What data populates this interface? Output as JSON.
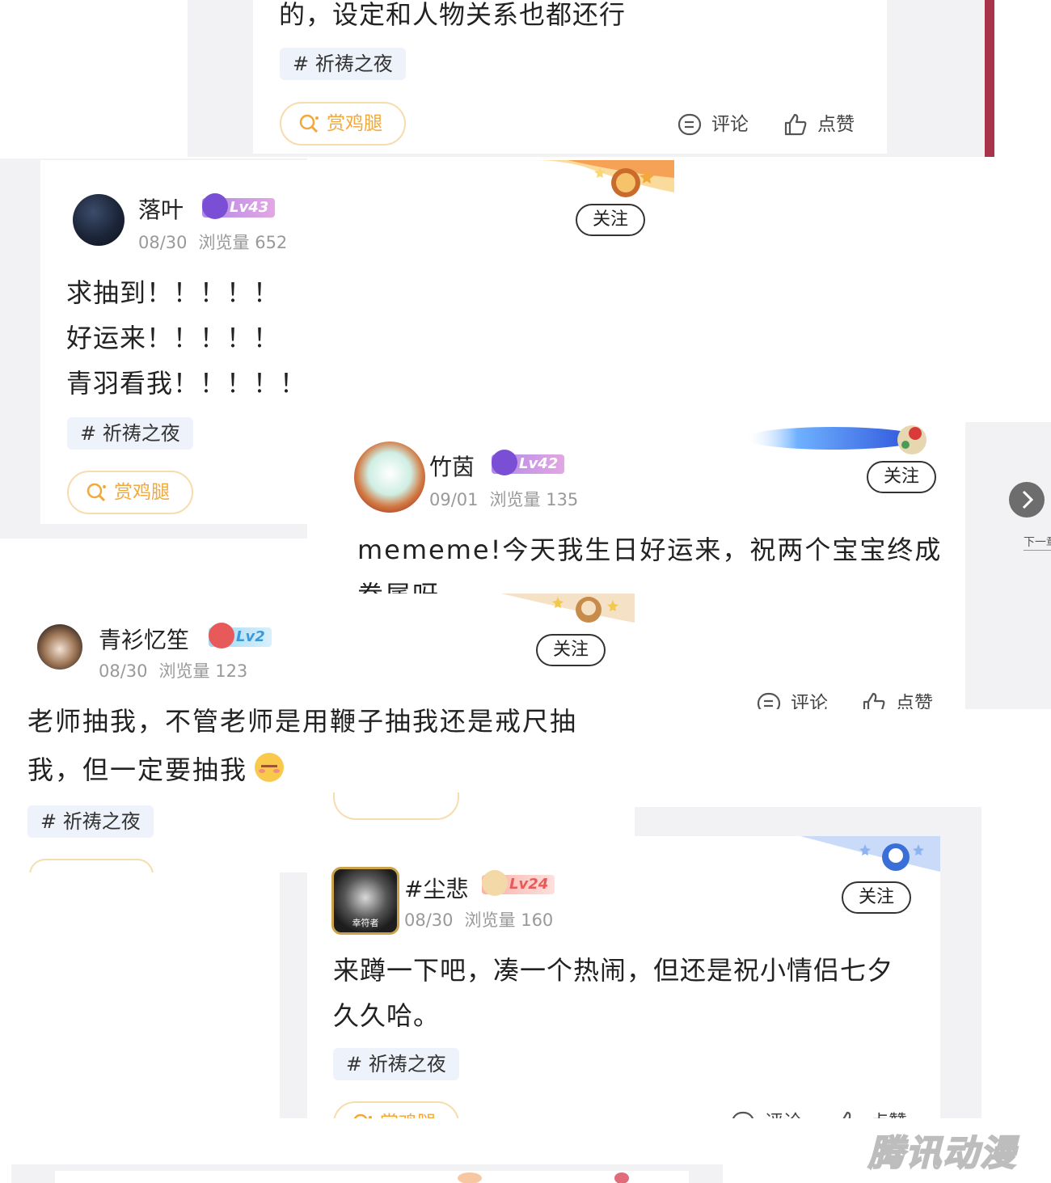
{
  "colors": {
    "accent_orange": "#f2a93b",
    "tag_bg": "#eef2fa",
    "meta_gray": "#999999",
    "side_strip": "#a8344a"
  },
  "top_card": {
    "text_line": "的，设定和人物关系也都还行",
    "tag": "# 祈祷之夜",
    "reward_label": "赏鸡腿",
    "comment_label": "评论",
    "like_label": "点赞"
  },
  "posts": [
    {
      "username": "落叶",
      "level": "Lv43",
      "date": "08/30",
      "views": "浏览量 652",
      "follow_label": "关注",
      "lines": [
        "求抽到！！！！！",
        "好运来！！！！！",
        "青羽看我！！！！！"
      ],
      "tag": "# 祈祷之夜",
      "reward_label": "赏鸡腿"
    },
    {
      "username": "竹茵",
      "level": "Lv42",
      "date": "09/01",
      "views": "浏览量 135",
      "follow_label": "关注",
      "lines": [
        "mememe!今天我生日好运来，祝两个宝宝终成",
        "眷属呀"
      ],
      "comment_label": "评论",
      "like_label": "点赞"
    },
    {
      "username": "青衫忆笙",
      "level": "Lv2",
      "date": "08/30",
      "views": "浏览量 123",
      "follow_label": "关注",
      "lines": [
        "老师抽我，不管老师是用鞭子抽我还是戒尺抽",
        "我，但一定要抽我"
      ],
      "tag": "# 祈祷之夜"
    },
    {
      "username": "#尘悲",
      "level": "Lv24",
      "date": "08/30",
      "views": "浏览量 160",
      "follow_label": "关注",
      "lines": [
        "来蹲一下吧，凑一个热闹，但还是祝小情侣七夕",
        "久久哈。"
      ],
      "tag": "# 祈祷之夜",
      "reward_label": "赏鸡腿",
      "comment_label": "评论",
      "like_label": "点赞",
      "avatar_caption": "幸符者"
    }
  ],
  "nav": {
    "next_label": "下一章",
    "next_icon": "chevron-right-icon"
  },
  "watermark": "腾讯动漫"
}
